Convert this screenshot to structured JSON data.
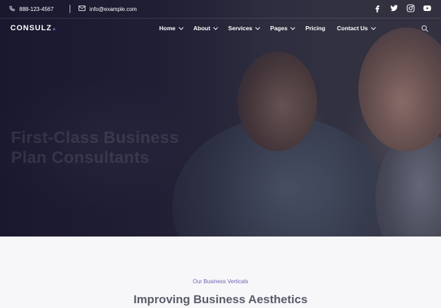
{
  "topbar": {
    "phone": "888-123-4567",
    "email": "info@example.com",
    "socials": [
      "facebook-icon",
      "twitter-icon",
      "instagram-icon",
      "youtube-icon"
    ]
  },
  "brand": {
    "logo": "CONSULZ"
  },
  "nav": {
    "items": [
      {
        "label": "Home",
        "dropdown": true
      },
      {
        "label": "About",
        "dropdown": true
      },
      {
        "label": "Services",
        "dropdown": true
      },
      {
        "label": "Pages",
        "dropdown": true
      },
      {
        "label": "Pricing",
        "dropdown": false
      },
      {
        "label": "Contact Us",
        "dropdown": true
      }
    ],
    "search_icon": "search-icon"
  },
  "hero": {
    "heading": "First-Class Business Plan Consultants"
  },
  "section": {
    "subtitle": "Our Business Verticals",
    "title": "Improving Business Aesthetics"
  },
  "colors": {
    "accent": "#6b63b8",
    "overlay": "#18162c",
    "title": "#585c68"
  }
}
